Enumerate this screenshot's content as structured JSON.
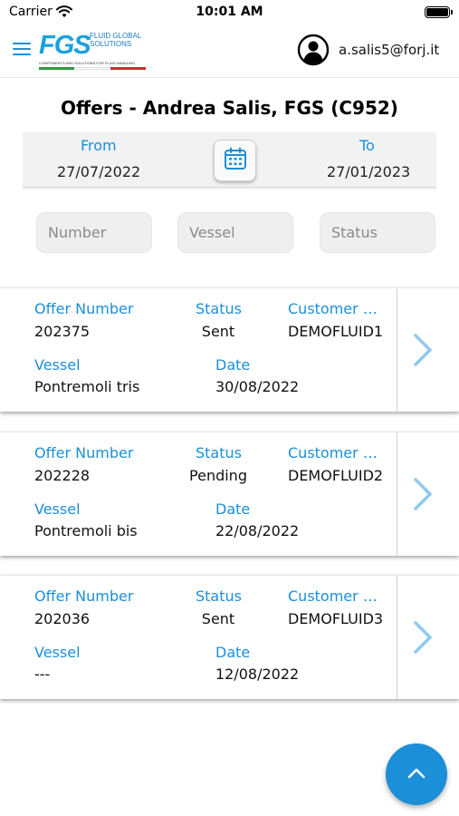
{
  "status_bar": {
    "carrier": "Carrier",
    "time": "10:01 AM"
  },
  "header": {
    "logo_text": "FGS",
    "logo_subtitle": "FLUID GLOBAL SOLUTIONS",
    "logo_tagline": "COMPONENTS AND SOLUTIONS FOR FLUID HANDLING",
    "user_email": "a.salis5@forj.it"
  },
  "page": {
    "title": "Offers - Andrea Salis, FGS (C952)"
  },
  "date_range": {
    "from_label": "From",
    "from_value": "27/07/2022",
    "to_label": "To",
    "to_value": "27/01/2023"
  },
  "filters": {
    "number_placeholder": "Number",
    "vessel_placeholder": "Vessel",
    "status_placeholder": "Status"
  },
  "labels": {
    "offer_number": "Offer Number",
    "status": "Status",
    "customer_ref": "Customer R...",
    "vessel": "Vessel",
    "date": "Date"
  },
  "offers": [
    {
      "number": "202375",
      "status": "Sent",
      "customer_ref": "DEMOFLUID1",
      "vessel": "Pontremoli tris",
      "date": "30/08/2022"
    },
    {
      "number": "202228",
      "status": "Pending",
      "customer_ref": "DEMOFLUID2",
      "vessel": "Pontremoli bis",
      "date": "22/08/2022"
    },
    {
      "number": "202036",
      "status": "Sent",
      "customer_ref": "DEMOFLUID3",
      "vessel": "---",
      "date": "12/08/2022"
    }
  ],
  "colors": {
    "accent": "#1b8fd8",
    "logo": "#1aa0e0",
    "chevron": "#8ec9ee"
  },
  "icons": [
    "wifi-icon",
    "battery-icon",
    "hamburger-menu-icon",
    "user-avatar-icon",
    "calendar-icon",
    "chevron-right-icon",
    "chevron-up-icon"
  ]
}
